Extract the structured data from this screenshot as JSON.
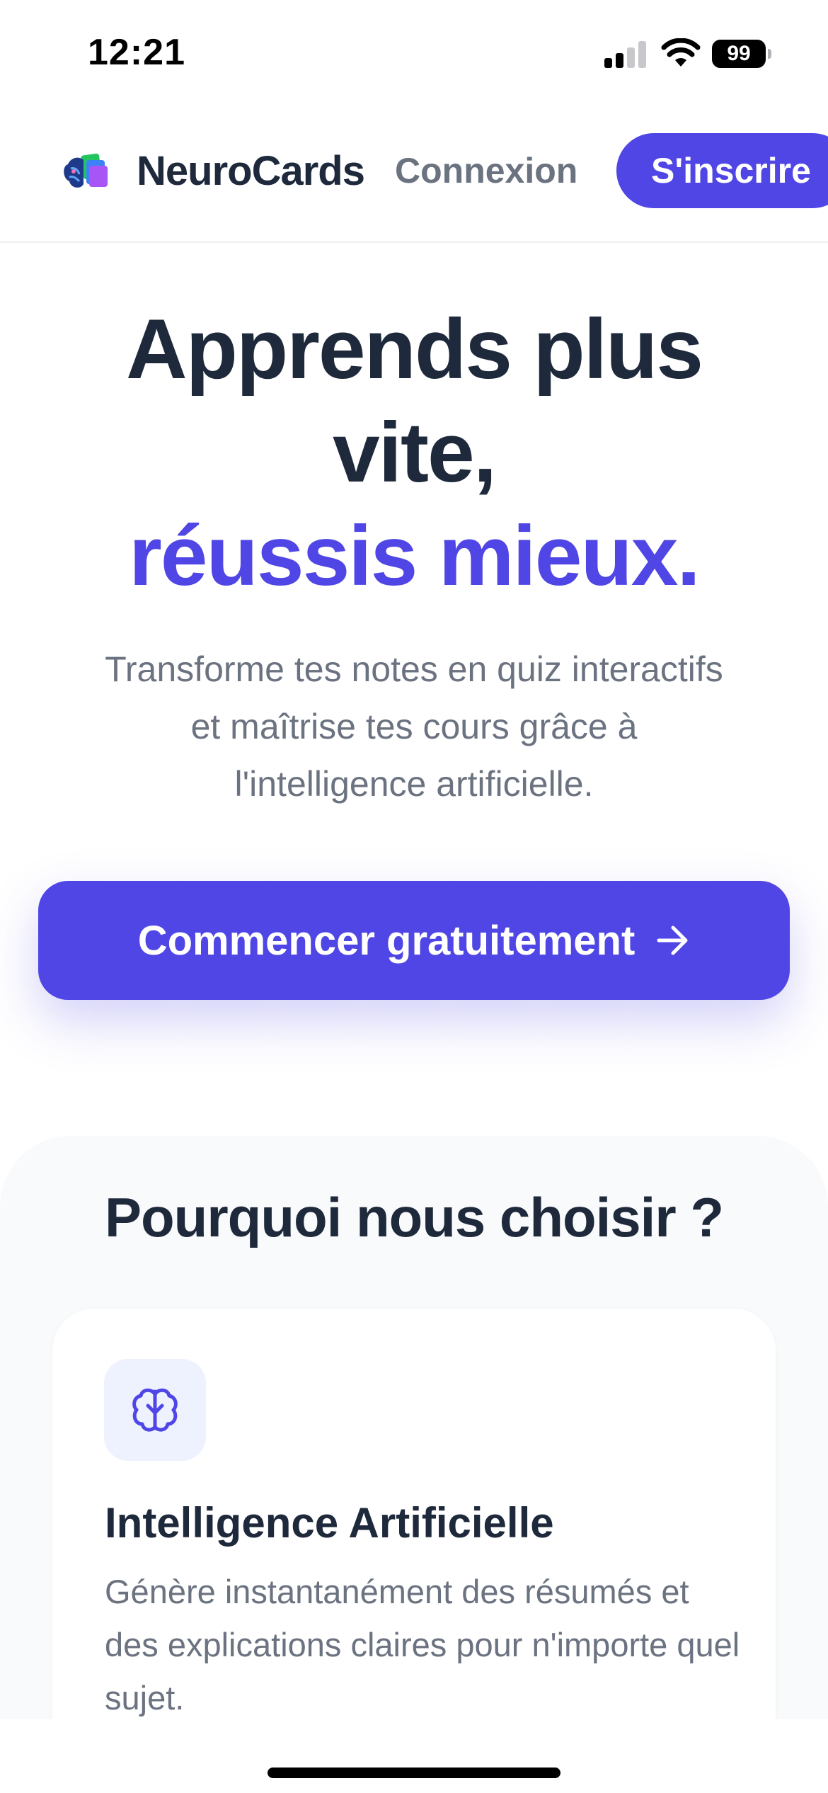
{
  "status_bar": {
    "time": "12:21",
    "battery": "99",
    "icons": [
      "signal-icon",
      "wifi-icon",
      "battery-icon"
    ]
  },
  "nav": {
    "logo_icon": "brain-cards-logo-icon",
    "brand": "NeuroCards",
    "login_label": "Connexion",
    "signup_label": "S'inscrire"
  },
  "hero": {
    "title_line1": "Apprends plus",
    "title_line2": "vite,",
    "title_accent": "réussis mieux.",
    "subtitle": "Transforme tes notes en quiz interactifs et maîtrise tes cours grâce à l'intelligence artificielle.",
    "cta_label": "Commencer gratuitement",
    "cta_icon": "arrow-right-icon"
  },
  "features": {
    "title": "Pourquoi nous choisir ?",
    "cards": [
      {
        "icon": "brain-icon",
        "title": "Intelligence Artificielle",
        "description": "Génère instantanément des résumés et des explications claires pour n'importe quel sujet."
      }
    ]
  },
  "colors": {
    "primary": "#4f46e5",
    "heading": "#1e293b",
    "body_text": "#6b7280",
    "section_bg": "#f9fafb",
    "icon_bg": "#eef2ff"
  }
}
